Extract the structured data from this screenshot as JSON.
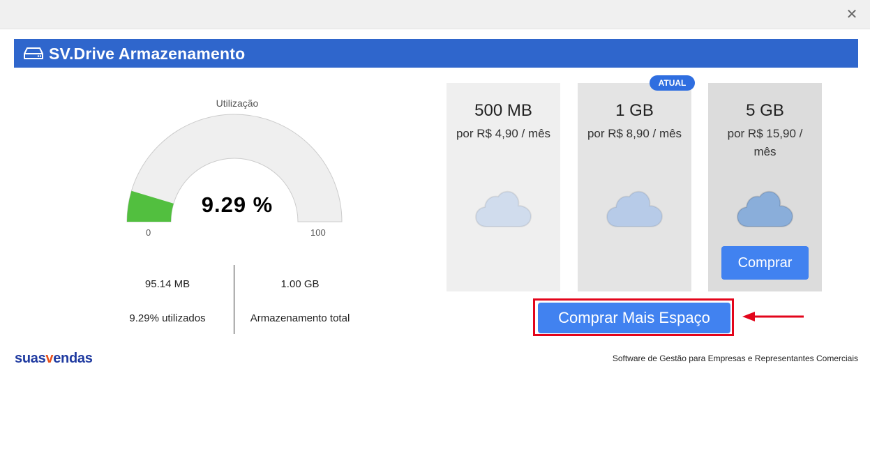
{
  "window": {
    "close_icon": "close-icon"
  },
  "header": {
    "title": "SV.Drive Armazenamento",
    "icon": "drive-icon",
    "color": "#2f66cc"
  },
  "gauge": {
    "label": "Utilização",
    "value_text": "9.29 %",
    "value": 9.29,
    "min": "0",
    "max": "100",
    "fill_color": "#52bf3f",
    "track_color": "#efefef"
  },
  "stats": {
    "used_amount": "95.14 MB",
    "used_percent_text": "9.29% utilizados",
    "total_amount": "1.00 GB",
    "total_label": "Armazenamento total"
  },
  "plans": [
    {
      "size": "500 MB",
      "price": "por R$ 4,90 / mês",
      "icon": "cloud-icon",
      "bg": "#efefef",
      "cloud_color": "#d0dced"
    },
    {
      "size": "1 GB",
      "price": "por R$ 8,90 / mês",
      "icon": "cloud-icon",
      "bg": "#e4e4e4",
      "cloud_color": "#b7cbe8",
      "badge": "ATUAL"
    },
    {
      "size": "5 GB",
      "price": "por R$ 15,90 / mês",
      "icon": "cloud-icon",
      "bg": "#dcdcdc",
      "cloud_color": "#8aaeda",
      "button": "Comprar"
    }
  ],
  "buy_more": {
    "label": "Comprar Mais Espaço",
    "highlight_color": "#e3051b"
  },
  "footer": {
    "logo_part1": "suas",
    "logo_part2": "v",
    "logo_part3": "endas",
    "tagline": "Software de Gestão para Empresas e Representantes Comerciais"
  }
}
